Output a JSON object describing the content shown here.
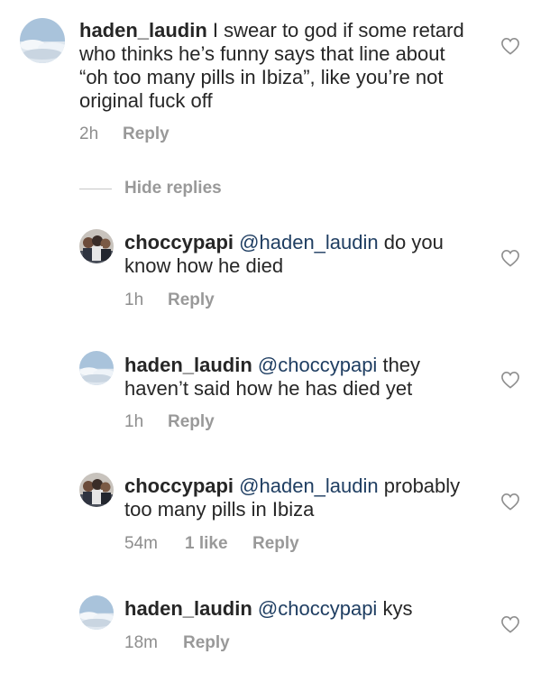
{
  "comments": [
    {
      "username": "haden_laudin",
      "mention": "",
      "text": "I swear to god if some retard who thinks he’s funny says that line about “oh too many pills in Ibiza”, like you’re not original fuck off",
      "time": "2h",
      "likes": "",
      "reply_label": "Reply"
    },
    {
      "username": "choccypapi",
      "mention": "@haden_laudin",
      "text": "do you know how he died",
      "time": "1h",
      "likes": "",
      "reply_label": "Reply"
    },
    {
      "username": "haden_laudin",
      "mention": "@choccypapi",
      "text": "they haven’t said how he has died yet",
      "time": "1h",
      "likes": "",
      "reply_label": "Reply"
    },
    {
      "username": "choccypapi",
      "mention": "@haden_laudin",
      "text": "probably too many pills in Ibiza",
      "time": "54m",
      "likes": "1 like",
      "reply_label": "Reply"
    },
    {
      "username": "haden_laudin",
      "mention": "@choccypapi",
      "text": "kys",
      "time": "18m",
      "likes": "",
      "reply_label": "Reply"
    }
  ],
  "hide_replies_label": "Hide replies",
  "icons": {
    "like": "heart-outline-icon",
    "avatar_sky": "sky-cloud-avatar",
    "avatar_group": "group-photo-avatar"
  },
  "colors": {
    "mention": "#1f3e62",
    "meta": "#8e8e8e",
    "action": "#999999",
    "text": "#262626"
  }
}
